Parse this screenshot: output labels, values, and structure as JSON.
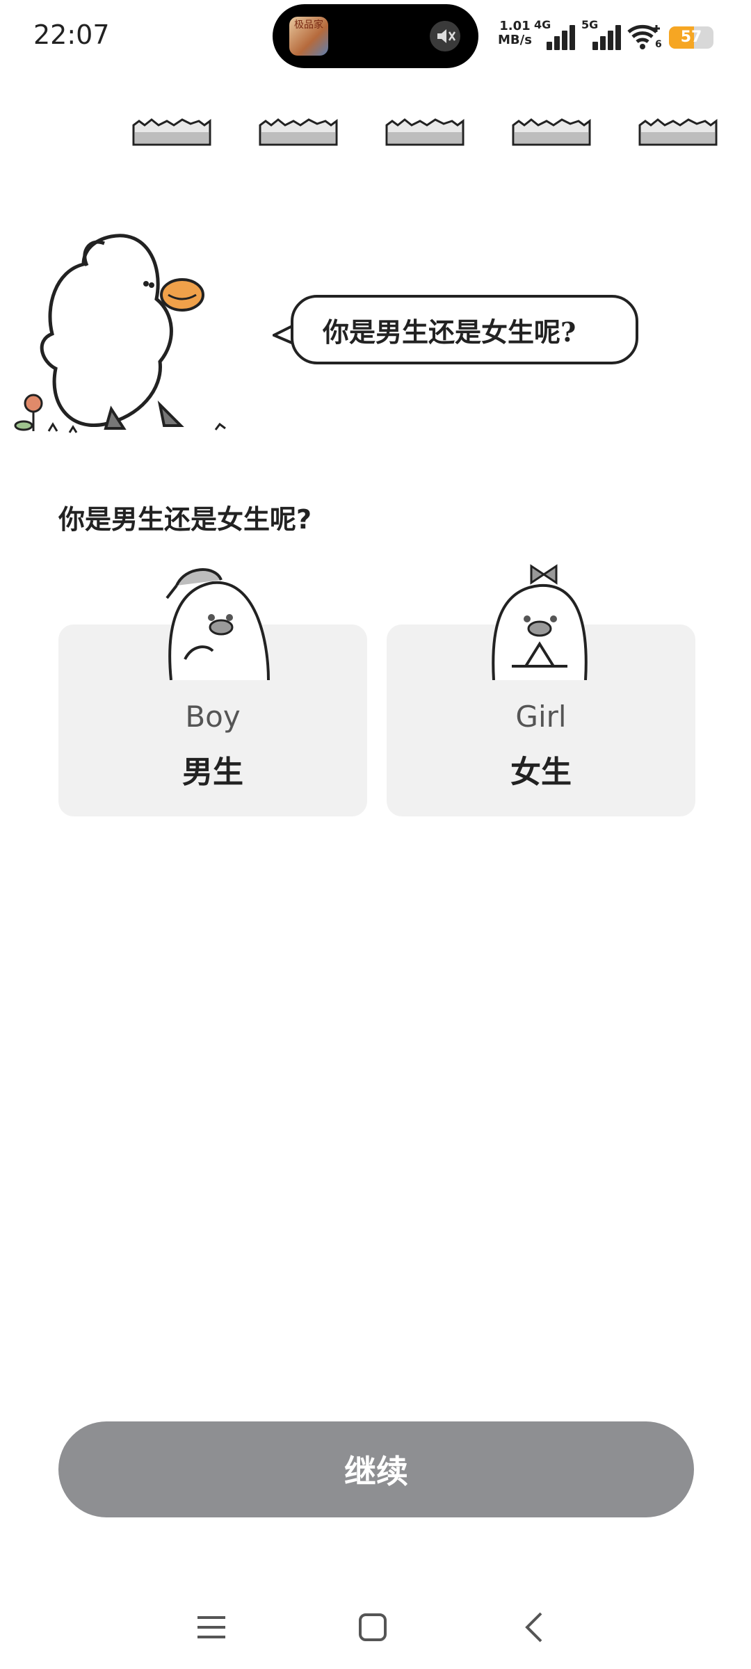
{
  "status_bar": {
    "time": "22:07",
    "netspeed_value": "1.01",
    "netspeed_unit": "MB/s",
    "sim1_label": "4G",
    "sim2_label": "5G",
    "wifi_sub": "6",
    "battery": "57",
    "battery_level_percent": 57,
    "island_app_text": "极品家"
  },
  "progress": {
    "segments": 5
  },
  "hero": {
    "bubble_text": "你是男生还是女生呢?"
  },
  "question": "你是男生还是女生呢?",
  "options": [
    {
      "en": "Boy",
      "zh": "男生"
    },
    {
      "en": "Girl",
      "zh": "女生"
    }
  ],
  "continue_label": "继续",
  "colors": {
    "button_disabled": "#8e8f92",
    "card_bg": "#f1f1f1",
    "battery": "#f6a623",
    "duck_beak": "#f0a14a"
  }
}
